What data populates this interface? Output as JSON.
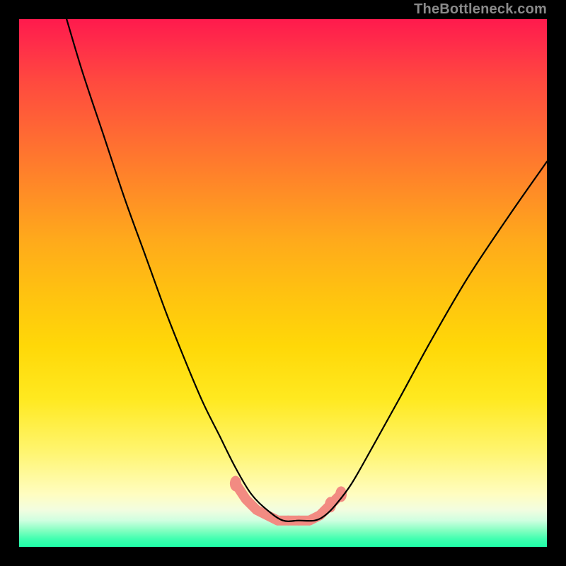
{
  "watermark": "TheBottleneck.com",
  "chart_data": {
    "type": "line",
    "title": "",
    "xlabel": "",
    "ylabel": "",
    "xlim": [
      0,
      100
    ],
    "ylim": [
      0,
      100
    ],
    "grid": false,
    "legend": false,
    "description": "V-shaped bottleneck curve over vertical red→yellow→green gradient. Single black curve descending steeply from top-left, reaching a flat minimum near x≈48–58 at y≈5, then rising toward top-right (not reaching full height). Salmon-pink cluster of marker dots along the valley.",
    "series": [
      {
        "name": "bottleneck-curve",
        "x": [
          9,
          12,
          16,
          20,
          24,
          28,
          32,
          35,
          38,
          41,
          44,
          47,
          50,
          53,
          56,
          58,
          60,
          63,
          67,
          72,
          78,
          85,
          93,
          100
        ],
        "y": [
          100,
          90,
          78,
          66,
          55,
          44,
          34,
          27,
          21,
          15,
          10,
          7,
          5,
          5,
          5,
          6,
          8,
          12,
          19,
          28,
          39,
          51,
          63,
          73
        ]
      }
    ],
    "valley_markers": {
      "color": "#f28b82",
      "points": [
        {
          "x": 41,
          "y": 12
        },
        {
          "x": 43,
          "y": 9
        },
        {
          "x": 45,
          "y": 7
        },
        {
          "x": 47,
          "y": 6
        },
        {
          "x": 49,
          "y": 5
        },
        {
          "x": 51,
          "y": 5
        },
        {
          "x": 53,
          "y": 5
        },
        {
          "x": 55,
          "y": 5
        },
        {
          "x": 57,
          "y": 6
        },
        {
          "x": 59,
          "y": 8
        },
        {
          "x": 61,
          "y": 10
        }
      ]
    },
    "gradient_stops": [
      {
        "pos": 0,
        "color": "#ff1a4d"
      },
      {
        "pos": 0.5,
        "color": "#ffd808"
      },
      {
        "pos": 0.9,
        "color": "#fffdc0"
      },
      {
        "pos": 1.0,
        "color": "#1fffa8"
      }
    ]
  }
}
